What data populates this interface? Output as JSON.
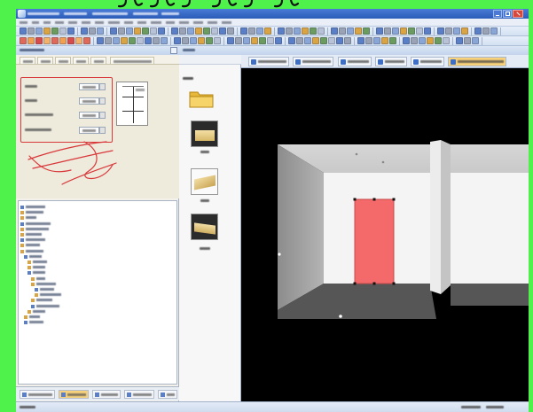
{
  "theme": {
    "outer_frame": "#4ef24a",
    "title_bar": "#2a5cb8",
    "menu_bar": "#e9eef7",
    "toolbar": "#d4e1f2",
    "property_panel": "#eeeadc",
    "viewport": "#000000",
    "annotation_ink": "#d9383a",
    "active_tab": "#f8d27a"
  },
  "icons": {
    "app": "app-icon",
    "minimize": "minimize-icon",
    "maximize": "maximize-icon",
    "close": "close-icon",
    "library_folder": "folder-icon",
    "view_tab": "view-tab-icon",
    "tree_node": "tree-node-icon"
  },
  "scene": {
    "selected_object_color": "#f46a6a",
    "wall_color": "#f4f4f4",
    "ceiling_color": "#c9c9c9",
    "floor_color": "#565656"
  }
}
